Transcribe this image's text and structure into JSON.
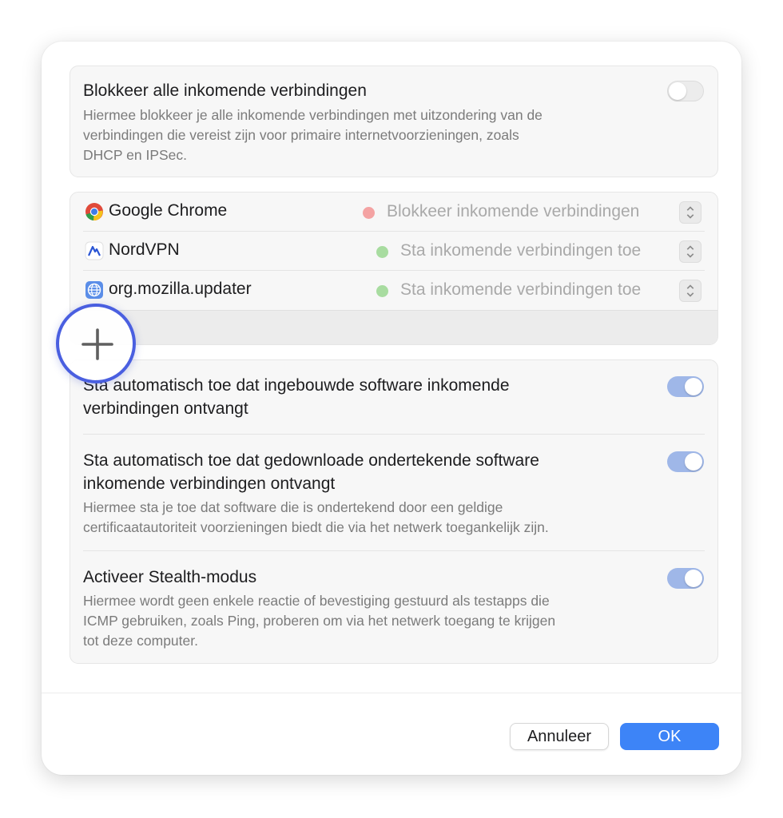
{
  "block_all": {
    "title": "Blokkeer alle inkomende verbindingen",
    "description_lines": [
      "Hiermee blokkeer je alle inkomende verbindingen met uitzondering van de",
      "verbindingen die vereist zijn voor primaire internetvoorzieningen, zoals",
      "DHCP en IPSec."
    ],
    "enabled": false
  },
  "apps": [
    {
      "name": "Google Chrome",
      "icon": "chrome-icon",
      "status": "Blokkeer inkomende verbindingen",
      "status_color": "#f4a3a3"
    },
    {
      "name": "NordVPN",
      "icon": "nordvpn-icon",
      "status": "Sta inkomende verbindingen toe",
      "status_color": "#a8dca0"
    },
    {
      "name": "org.mozilla.updater",
      "icon": "globe-app-icon",
      "status": "Sta inkomende verbindingen toe",
      "status_color": "#a8dca0"
    }
  ],
  "options": {
    "builtin": {
      "title_lines": [
        "Sta automatisch toe dat ingebouwde software inkomende",
        "verbindingen ontvangt"
      ],
      "enabled": true
    },
    "signed": {
      "title_lines": [
        "Sta automatisch toe dat gedownloade ondertekende software",
        "inkomende verbindingen ontvangt"
      ],
      "description_lines": [
        "Hiermee sta je toe dat software die is ondertekend door een geldige",
        "certificaatautoriteit voorzieningen biedt die via het netwerk toegankelijk zijn."
      ],
      "enabled": true
    },
    "stealth": {
      "title": "Activeer Stealth-modus",
      "description_lines": [
        "Hiermee wordt geen enkele reactie of bevestiging gestuurd als testapps die",
        "ICMP gebruiken, zoals Ping, proberen om via het netwerk toegang te krijgen",
        "tot deze computer."
      ],
      "enabled": true
    }
  },
  "buttons": {
    "cancel": "Annuleer",
    "ok": "OK"
  },
  "colors": {
    "accent": "#3d84f7",
    "highlight_ring": "#4a5fe0",
    "toggle_on": "#9fb7e8"
  },
  "icons": {
    "add": "plus-icon",
    "stepper": "up-down-chevron-icon"
  }
}
